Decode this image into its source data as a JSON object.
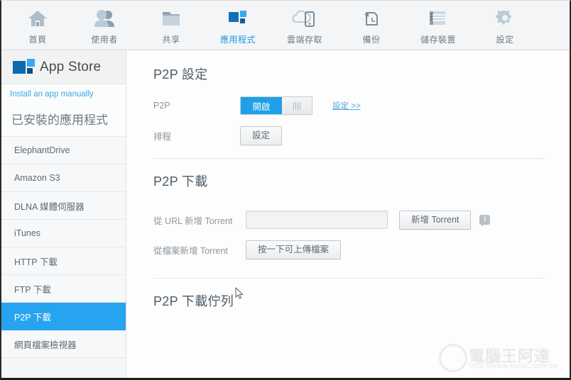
{
  "topnav": {
    "items": [
      {
        "label": "首頁",
        "icon": "home-icon",
        "active": false
      },
      {
        "label": "使用者",
        "icon": "users-icon",
        "active": false
      },
      {
        "label": "共享",
        "icon": "folder-share-icon",
        "active": false
      },
      {
        "label": "應用程式",
        "icon": "apps-icon",
        "active": true
      },
      {
        "label": "雲端存取",
        "icon": "cloud-access-icon",
        "active": false
      },
      {
        "label": "備份",
        "icon": "backup-icon",
        "active": false
      },
      {
        "label": "儲存裝置",
        "icon": "storage-icon",
        "active": false
      },
      {
        "label": "設定",
        "icon": "gear-icon",
        "active": false
      }
    ]
  },
  "sidebar": {
    "store_title": "App Store",
    "store_logo_icon": "app-store-squares-icon",
    "manual_link": "Install an app manually",
    "installed_title": "已安裝的應用程式",
    "apps": [
      {
        "label": "ElephantDrive",
        "selected": false
      },
      {
        "label": "Amazon S3",
        "selected": false
      },
      {
        "label": "DLNA 媒體伺服器",
        "selected": false
      },
      {
        "label": "iTunes",
        "selected": false
      },
      {
        "label": "HTTP 下載",
        "selected": false
      },
      {
        "label": "FTP 下載",
        "selected": false
      },
      {
        "label": "P2P 下載",
        "selected": true
      },
      {
        "label": "網頁檔案檢視器",
        "selected": false
      }
    ]
  },
  "main": {
    "settings_section": {
      "title": "P2P 設定",
      "p2p_label": "P2P",
      "toggle_on_label": "開啟",
      "toggle_state": "on",
      "config_link": "設定 >>",
      "schedule_label": "排程",
      "schedule_button": "設定"
    },
    "download_section": {
      "title": "P2P 下載",
      "url_label": "從 URL 新增 Torrent",
      "url_value": "",
      "url_placeholder": "",
      "add_torrent_button": "新增 Torrent",
      "info_icon": "info-bubble-icon",
      "info_glyph": "i",
      "file_label": "從檔案新增 Torrent",
      "upload_button": "按一下可上傳檔案"
    },
    "queue_section": {
      "title": "P2P 下載佇列"
    }
  },
  "watermark": {
    "text": "電腦王阿達",
    "url": "http://www.kocpc.com.tw"
  },
  "colors": {
    "accent": "#27a4ef",
    "toggle_on": "#1f9fe8",
    "nav_active": "#2196e3",
    "link": "#3ba8e8"
  }
}
